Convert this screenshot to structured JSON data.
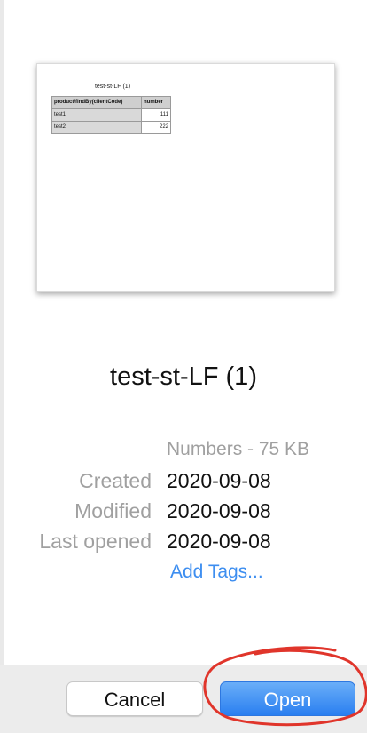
{
  "document": {
    "sheet_title": "test-st-LF (1)",
    "table_headers": [
      "product/findBy(clientCode)",
      "number"
    ],
    "table_rows": [
      {
        "name": "test1",
        "number": "111"
      },
      {
        "name": "test2",
        "number": "222"
      }
    ]
  },
  "file": {
    "title": "test-st-LF (1)",
    "kind_size": "Numbers - 75 KB",
    "created_label": "Created",
    "created_value": "2020-09-08",
    "modified_label": "Modified",
    "modified_value": "2020-09-08",
    "last_opened_label": "Last opened",
    "last_opened_value": "2020-09-08",
    "add_tags": "Add Tags..."
  },
  "buttons": {
    "cancel": "Cancel",
    "open": "Open"
  },
  "colors": {
    "accent": "#2a7ff0",
    "link": "#3d8ef0",
    "annotation": "#e0352b"
  }
}
